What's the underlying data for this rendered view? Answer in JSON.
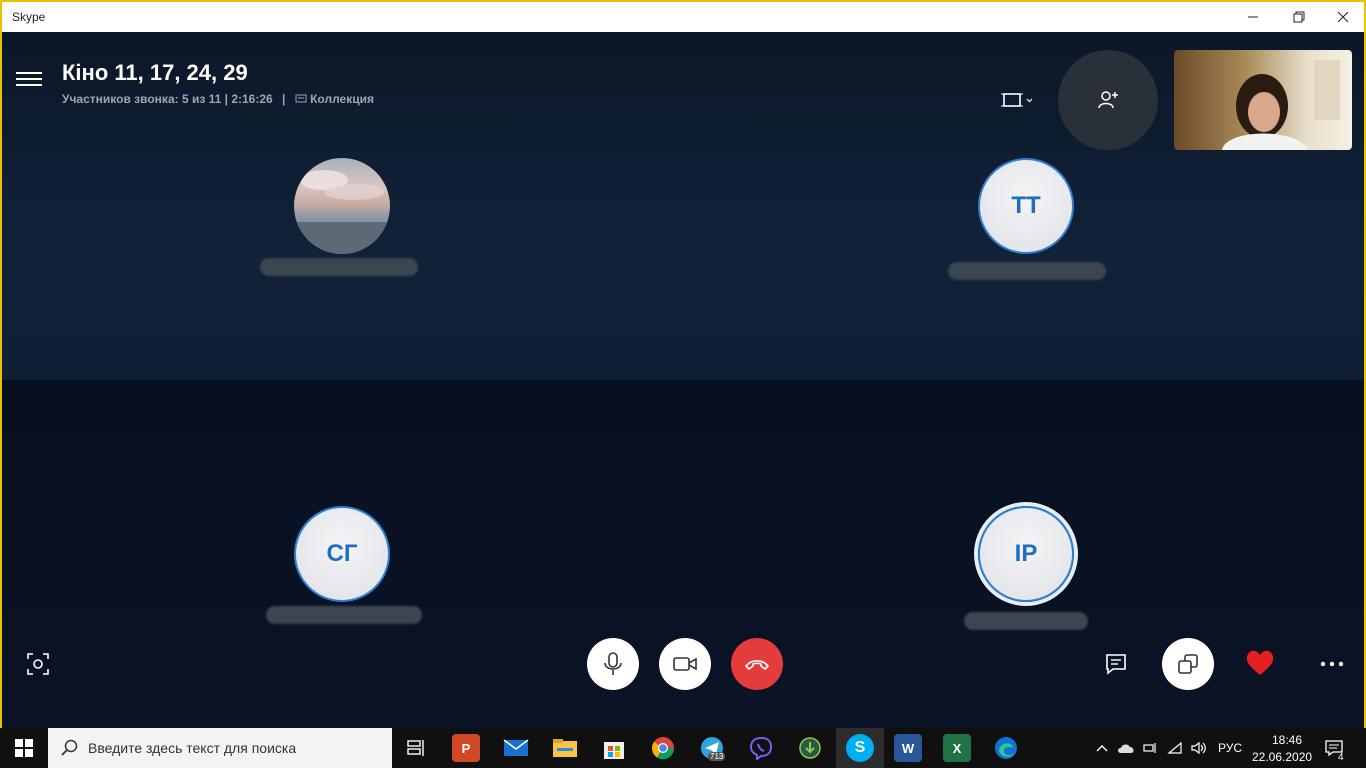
{
  "window": {
    "app_title": "Skype",
    "controls": [
      "minimize",
      "restore",
      "close"
    ]
  },
  "call": {
    "title": "Кіно 11, 17, 24, 29",
    "participants_text": "Участников звонка: 5 из 11 | 2:16:26",
    "separator": "|",
    "gallery_label": "Коллекция"
  },
  "participants": [
    {
      "initials": "",
      "avatar": "photo"
    },
    {
      "initials": "ТТ",
      "avatar": "initials"
    },
    {
      "initials": "СГ",
      "avatar": "initials"
    },
    {
      "initials": "ІР",
      "avatar": "initials",
      "speaking": true
    }
  ],
  "controls": {
    "left": [
      "screenshot-icon"
    ],
    "center": [
      "mic-icon",
      "video-icon",
      "hang-up-icon"
    ],
    "right": [
      "chat-icon",
      "share-screen-icon",
      "heart-icon",
      "more-icon"
    ]
  },
  "taskbar": {
    "search_placeholder": "Введите здесь текст для поиска",
    "apps": [
      "task-view",
      "powerpoint",
      "mail",
      "file-explorer",
      "store",
      "chrome",
      "telegram",
      "viber",
      "app",
      "skype",
      "word",
      "excel",
      "edge"
    ],
    "telegram_badge": "713",
    "language": "РУС",
    "time": "18:46",
    "date": "22.06.2020",
    "notifications": "4"
  },
  "colors": {
    "accent": "#2d7fd1",
    "hangup": "#e63b3b",
    "heart": "#e52020",
    "frame_border": "#e8c400"
  }
}
